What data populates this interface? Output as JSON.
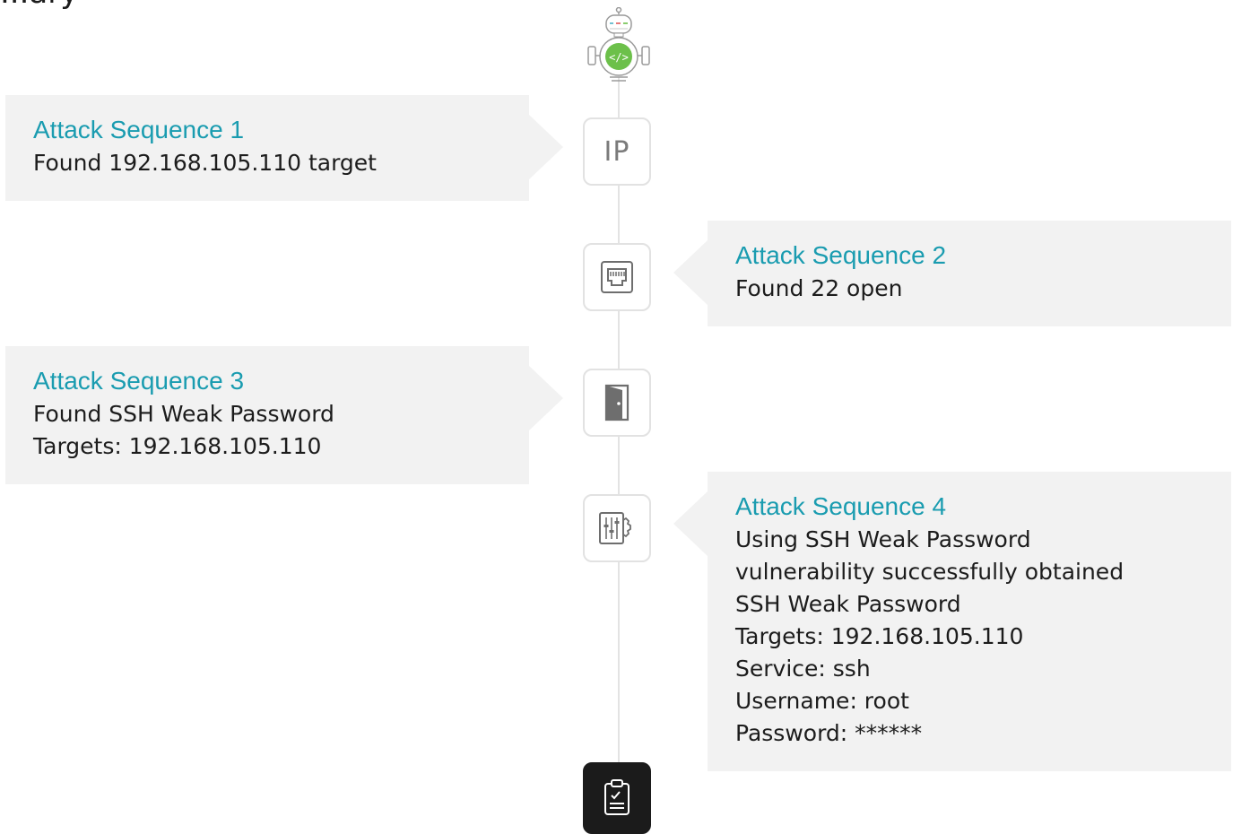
{
  "top_clip_text": "...ary",
  "sequences": [
    {
      "title": "Attack Sequence 1",
      "lines": [
        "Found 192.168.105.110 target"
      ]
    },
    {
      "title": "Attack Sequence 2",
      "lines": [
        "Found 22 open"
      ]
    },
    {
      "title": "Attack Sequence 3",
      "lines": [
        "Found SSH Weak Password",
        "Targets: 192.168.105.110"
      ]
    },
    {
      "title": "Attack Sequence 4",
      "lines": [
        "Using SSH Weak Password",
        "vulnerability successfully obtained",
        "SSH Weak Password",
        "Targets: 192.168.105.110",
        "Service: ssh",
        "Username: root",
        "Password: ******"
      ]
    }
  ],
  "nodes": {
    "ip_label": "IP"
  },
  "icons": [
    "robot-avatar-icon",
    "ip-icon",
    "ethernet-port-icon",
    "door-icon",
    "config-sliders-icon",
    "clipboard-check-icon"
  ],
  "colors": {
    "title_accent": "#1a9cb0",
    "card_bg": "#f2f2f2",
    "node_border": "#e2e2e2",
    "report_node_bg": "#1b1b1b",
    "robot_badge": "#6cc04a"
  }
}
